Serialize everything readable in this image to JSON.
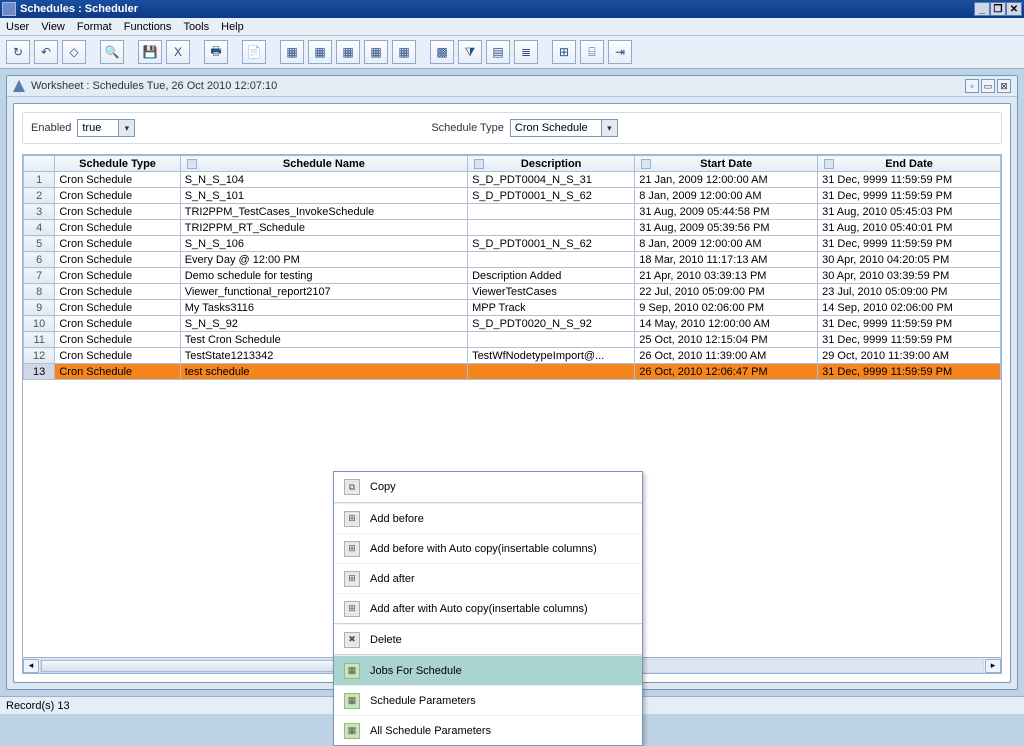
{
  "window": {
    "title": "Schedules : Scheduler",
    "worksheet_title": "Worksheet : Schedules Tue, 26 Oct 2010 12:07:10",
    "record_count": "Record(s) 13"
  },
  "menu": [
    "User",
    "View",
    "Format",
    "Functions",
    "Tools",
    "Help"
  ],
  "filters": {
    "enabled_label": "Enabled",
    "enabled_value": "true",
    "schedule_type_label": "Schedule Type",
    "schedule_type_value": "Cron Schedule"
  },
  "columns": [
    "Schedule Type",
    "Schedule Name",
    "Description",
    "Start Date",
    "End Date"
  ],
  "rows": [
    {
      "n": "1",
      "type": "Cron Schedule",
      "name": "S_N_S_104",
      "desc": "S_D_PDT0004_N_S_31",
      "start": "21 Jan, 2009 12:00:00 AM",
      "end": "31 Dec, 9999 11:59:59 PM"
    },
    {
      "n": "2",
      "type": "Cron Schedule",
      "name": "S_N_S_101",
      "desc": "S_D_PDT0001_N_S_62",
      "start": "8 Jan, 2009 12:00:00 AM",
      "end": "31 Dec, 9999 11:59:59 PM"
    },
    {
      "n": "3",
      "type": "Cron Schedule",
      "name": "TRI2PPM_TestCases_InvokeSchedule",
      "desc": "",
      "start": "31 Aug, 2009 05:44:58 PM",
      "end": "31 Aug, 2010 05:45:03 PM"
    },
    {
      "n": "4",
      "type": "Cron Schedule",
      "name": "TRI2PPM_RT_Schedule",
      "desc": "",
      "start": "31 Aug, 2009 05:39:56 PM",
      "end": "31 Aug, 2010 05:40:01 PM"
    },
    {
      "n": "5",
      "type": "Cron Schedule",
      "name": "S_N_S_106",
      "desc": "S_D_PDT0001_N_S_62",
      "start": "8 Jan, 2009 12:00:00 AM",
      "end": "31 Dec, 9999 11:59:59 PM"
    },
    {
      "n": "6",
      "type": "Cron Schedule",
      "name": "Every Day @ 12:00 PM",
      "desc": "",
      "start": "18 Mar, 2010 11:17:13 AM",
      "end": "30 Apr, 2010 04:20:05 PM"
    },
    {
      "n": "7",
      "type": "Cron Schedule",
      "name": "Demo schedule for testing",
      "desc": "Description Added",
      "start": "21 Apr, 2010 03:39:13 PM",
      "end": "30 Apr, 2010 03:39:59 PM"
    },
    {
      "n": "8",
      "type": "Cron Schedule",
      "name": "Viewer_functional_report2107",
      "desc": "ViewerTestCases",
      "start": "22 Jul, 2010 05:09:00 PM",
      "end": "23 Jul, 2010 05:09:00 PM"
    },
    {
      "n": "9",
      "type": "Cron Schedule",
      "name": "My Tasks3116",
      "desc": "MPP Track",
      "start": "9 Sep, 2010 02:06:00 PM",
      "end": "14 Sep, 2010 02:06:00 PM"
    },
    {
      "n": "10",
      "type": "Cron Schedule",
      "name": "S_N_S_92",
      "desc": "S_D_PDT0020_N_S_92",
      "start": "14 May, 2010 12:00:00 AM",
      "end": "31 Dec, 9999 11:59:59 PM"
    },
    {
      "n": "11",
      "type": "Cron Schedule",
      "name": "Test Cron Schedule",
      "desc": "",
      "start": "25 Oct, 2010 12:15:04 PM",
      "end": "31 Dec, 9999 11:59:59 PM"
    },
    {
      "n": "12",
      "type": "Cron Schedule",
      "name": "TestState1213342",
      "desc": "TestWfNodetypeImport@...",
      "start": "26 Oct, 2010 11:39:00 AM",
      "end": "29 Oct, 2010 11:39:00 AM"
    },
    {
      "n": "13",
      "type": "Cron Schedule",
      "name": "test schedule",
      "desc": "",
      "start": "26 Oct, 2010 12:06:47 PM",
      "end": "31 Dec, 9999 11:59:59 PM",
      "sel": true
    }
  ],
  "ctx": {
    "copy": "Copy",
    "add_before": "Add before",
    "add_before_auto": "Add before with Auto copy(insertable columns)",
    "add_after": "Add after",
    "add_after_auto": "Add after with Auto copy(insertable columns)",
    "delete": "Delete",
    "jobs": "Jobs For Schedule",
    "params": "Schedule Parameters",
    "all_params": "All Schedule Parameters"
  }
}
